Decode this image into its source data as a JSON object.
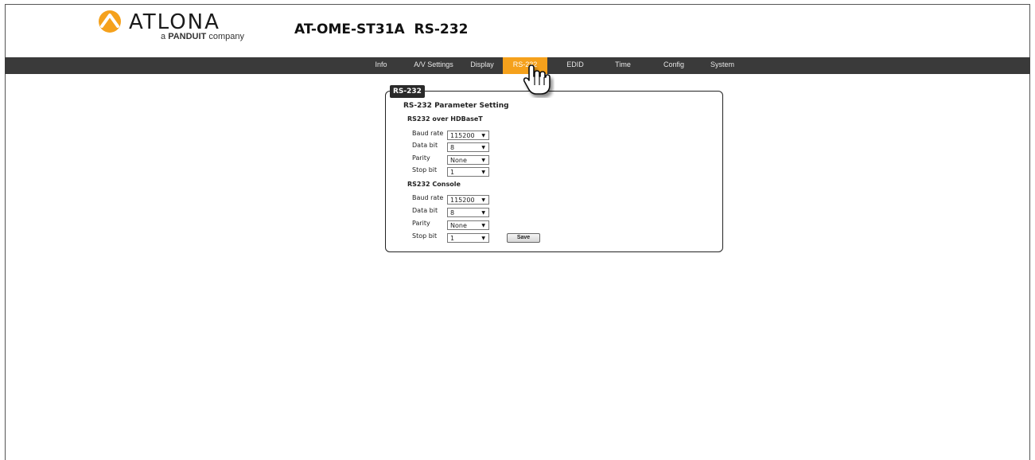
{
  "header": {
    "brand_name": "ATLONA",
    "brand_sub_prefix": "a",
    "brand_sub_bold": "PANDUIT",
    "brand_sub_suffix": "company",
    "page_title": "AT-OME-ST31A  RS-232",
    "logo_color": "#f5a11c"
  },
  "nav": {
    "items": [
      {
        "label": "Info"
      },
      {
        "label": "A/V Settings"
      },
      {
        "label": "Display"
      },
      {
        "label": "RS-232",
        "active": true
      },
      {
        "label": "EDID"
      },
      {
        "label": "Time"
      },
      {
        "label": "Config"
      },
      {
        "label": "System"
      }
    ],
    "active_color": "#f5a11c",
    "bar_color": "#3a3a3a"
  },
  "panel": {
    "tab_label": "RS-232",
    "heading": "RS-232 Parameter Setting",
    "hdbaset": {
      "title": "RS232 over HDBaseT",
      "baud_rate": {
        "label": "Baud rate",
        "value": "115200"
      },
      "data_bit": {
        "label": "Data bit",
        "value": "8"
      },
      "parity": {
        "label": "Parity",
        "value": "None"
      },
      "stop_bit": {
        "label": "Stop bit",
        "value": "1"
      }
    },
    "console": {
      "title": "RS232 Console",
      "baud_rate": {
        "label": "Baud rate",
        "value": "115200"
      },
      "data_bit": {
        "label": "Data bit",
        "value": "8"
      },
      "parity": {
        "label": "Parity",
        "value": "None"
      },
      "stop_bit": {
        "label": "Stop bit",
        "value": "1"
      }
    },
    "save_label": "Save"
  },
  "icons": {
    "logo": "atlona-logo-icon",
    "dropdown": "caret-down-icon",
    "cursor": "hand-pointer-icon"
  }
}
